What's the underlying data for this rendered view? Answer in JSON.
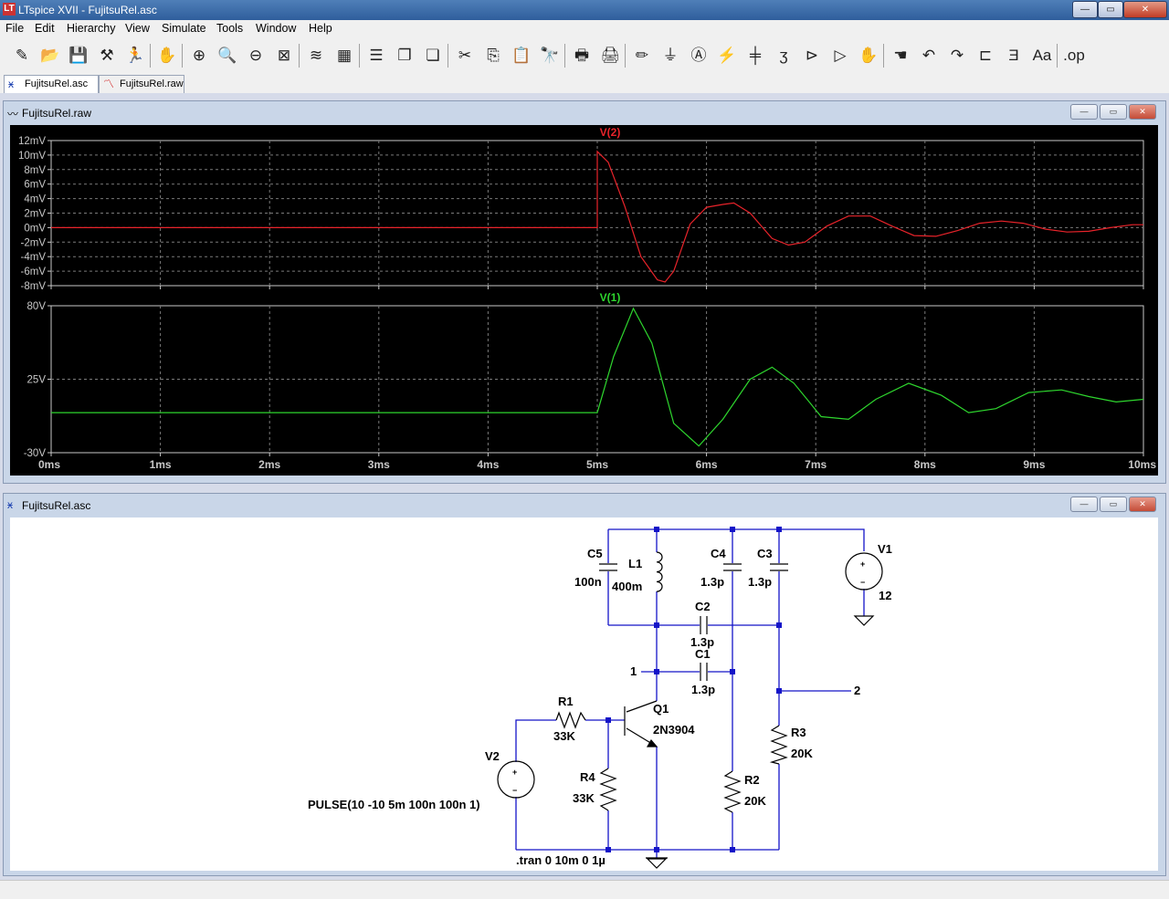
{
  "app": {
    "title": "LTspice XVII - FujitsuRel.asc",
    "app_icon": "LT"
  },
  "window_controls": {
    "minimize": "—",
    "maximize": "▭",
    "close": "✕"
  },
  "menu": [
    "File",
    "Edit",
    "Hierarchy",
    "View",
    "Simulate",
    "Tools",
    "Window",
    "Help"
  ],
  "toolbar_icons": [
    {
      "name": "new-schematic-icon",
      "glyph": "✎"
    },
    {
      "name": "open-icon",
      "glyph": "📂"
    },
    {
      "name": "save-icon",
      "glyph": "💾"
    },
    {
      "name": "control-panel-icon",
      "glyph": "⚒"
    },
    {
      "name": "run-icon",
      "glyph": "🏃"
    },
    {
      "name": "halt-icon",
      "glyph": "✋"
    },
    {
      "name": "zoom-in-icon",
      "glyph": "⊕"
    },
    {
      "name": "zoom-pan-icon",
      "glyph": "🔍"
    },
    {
      "name": "zoom-out-icon",
      "glyph": "⊖"
    },
    {
      "name": "zoom-fit-icon",
      "glyph": "⊠"
    },
    {
      "name": "autorange-icon",
      "glyph": "≋"
    },
    {
      "name": "view-netlist-icon",
      "glyph": "▦"
    },
    {
      "name": "tile-horizontal-icon",
      "glyph": "☰"
    },
    {
      "name": "cascade-icon",
      "glyph": "❐"
    },
    {
      "name": "tile-vertical-icon",
      "glyph": "❏"
    },
    {
      "name": "cut-icon",
      "glyph": "✂"
    },
    {
      "name": "copy-icon",
      "glyph": "⎘"
    },
    {
      "name": "paste-icon",
      "glyph": "📋"
    },
    {
      "name": "find-icon",
      "glyph": "🔭"
    },
    {
      "name": "print-icon",
      "glyph": "🖶"
    },
    {
      "name": "print-setup-icon",
      "glyph": "🖨"
    },
    {
      "name": "draw-wire-icon",
      "glyph": "✏"
    },
    {
      "name": "ground-icon",
      "glyph": "⏚"
    },
    {
      "name": "label-net-icon",
      "glyph": "Ⓐ"
    },
    {
      "name": "resistor-icon",
      "glyph": "⚡"
    },
    {
      "name": "capacitor-icon",
      "glyph": "╪"
    },
    {
      "name": "inductor-icon",
      "glyph": "ʒ"
    },
    {
      "name": "diode-icon",
      "glyph": "⊳"
    },
    {
      "name": "component-icon",
      "glyph": "▷"
    },
    {
      "name": "move-icon",
      "glyph": "✋"
    },
    {
      "name": "drag-icon",
      "glyph": "☚"
    },
    {
      "name": "undo-icon",
      "glyph": "↶"
    },
    {
      "name": "redo-icon",
      "glyph": "↷"
    },
    {
      "name": "rotate-icon",
      "glyph": "⊏"
    },
    {
      "name": "mirror-icon",
      "glyph": "Ǝ"
    },
    {
      "name": "text-icon",
      "glyph": "Aa"
    },
    {
      "name": "spice-directive-icon",
      "glyph": ".op"
    }
  ],
  "tabs": [
    {
      "label": "FujitsuRel.asc",
      "icon": "schematic-icon",
      "active": true
    },
    {
      "label": "FujitsuRel.raw",
      "icon": "waveform-icon",
      "active": false
    }
  ],
  "waveform_window": {
    "title": "FujitsuRel.raw"
  },
  "schematic_window": {
    "title": "FujitsuRel.asc"
  },
  "chart_data": [
    {
      "type": "line",
      "title": "V(2)",
      "color": "#e8232a",
      "ylim": [
        -8,
        12
      ],
      "yticks": [
        "12mV",
        "10mV",
        "8mV",
        "6mV",
        "4mV",
        "2mV",
        "0mV",
        "-2mV",
        "-4mV",
        "-6mV",
        "-8mV"
      ],
      "ytick_values": [
        12,
        10,
        8,
        6,
        4,
        2,
        0,
        -2,
        -4,
        -6,
        -8
      ],
      "xlim": [
        0,
        10
      ],
      "grid": true,
      "x": [
        0,
        5,
        5,
        5.1,
        5.25,
        5.4,
        5.55,
        5.62,
        5.7,
        5.85,
        6.0,
        6.15,
        6.25,
        6.4,
        6.6,
        6.75,
        6.9,
        7.1,
        7.3,
        7.5,
        7.7,
        7.9,
        8.1,
        8.3,
        8.5,
        8.7,
        8.9,
        9.1,
        9.3,
        9.5,
        9.7,
        9.9,
        10
      ],
      "y": [
        0,
        0,
        10.5,
        9,
        3,
        -4,
        -7.2,
        -7.5,
        -6,
        0.5,
        2.8,
        3.2,
        3.4,
        2,
        -1.5,
        -2.4,
        -2,
        0.2,
        1.6,
        1.6,
        0.2,
        -1.1,
        -1.2,
        -0.4,
        0.6,
        0.9,
        0.6,
        -0.2,
        -0.6,
        -0.5,
        0,
        0.4,
        0.4
      ]
    },
    {
      "type": "line",
      "title": "V(1)",
      "color": "#2ed62e",
      "ylim": [
        -30,
        80
      ],
      "yticks": [
        "80V",
        "25V",
        "-30V"
      ],
      "ytick_values": [
        80,
        25,
        -30
      ],
      "xlim": [
        0,
        10
      ],
      "xticks": [
        "0ms",
        "1ms",
        "2ms",
        "3ms",
        "4ms",
        "5ms",
        "6ms",
        "7ms",
        "8ms",
        "9ms",
        "10ms"
      ],
      "grid": true,
      "x": [
        0,
        5,
        5.15,
        5.33,
        5.5,
        5.7,
        5.93,
        6.15,
        6.4,
        6.6,
        6.8,
        7.05,
        7.3,
        7.55,
        7.85,
        8.15,
        8.4,
        8.65,
        8.95,
        9.25,
        9.5,
        9.75,
        10
      ],
      "y": [
        0,
        0,
        42,
        78,
        52,
        -8,
        -25,
        -5,
        25,
        34,
        22,
        -3,
        -5,
        10,
        22,
        13,
        0,
        3,
        15,
        17,
        12,
        8,
        10
      ]
    }
  ],
  "schematic": {
    "components": [
      {
        "id": "c5",
        "ref": "C5",
        "value": "100n"
      },
      {
        "id": "l1",
        "ref": "L1",
        "value": "400m"
      },
      {
        "id": "c4",
        "ref": "C4",
        "value": "1.3p"
      },
      {
        "id": "c3",
        "ref": "C3",
        "value": "1.3p"
      },
      {
        "id": "v1",
        "ref": "V1",
        "value": "12"
      },
      {
        "id": "c2",
        "ref": "C2",
        "value": "1.3p"
      },
      {
        "id": "c1",
        "ref": "C1",
        "value": "1.3p"
      },
      {
        "id": "r1",
        "ref": "R1",
        "value": "33K"
      },
      {
        "id": "q1",
        "ref": "Q1",
        "value": "2N3904"
      },
      {
        "id": "r3",
        "ref": "R3",
        "value": "20K"
      },
      {
        "id": "v2",
        "ref": "V2",
        "value": "PULSE(10 -10 5m 100n 100n 1)"
      },
      {
        "id": "r4",
        "ref": "R4",
        "value": "33K"
      },
      {
        "id": "r2",
        "ref": "R2",
        "value": "20K"
      }
    ],
    "net_labels": [
      "1",
      "2"
    ],
    "directive": ".tran 0 10m 0 1µ"
  }
}
